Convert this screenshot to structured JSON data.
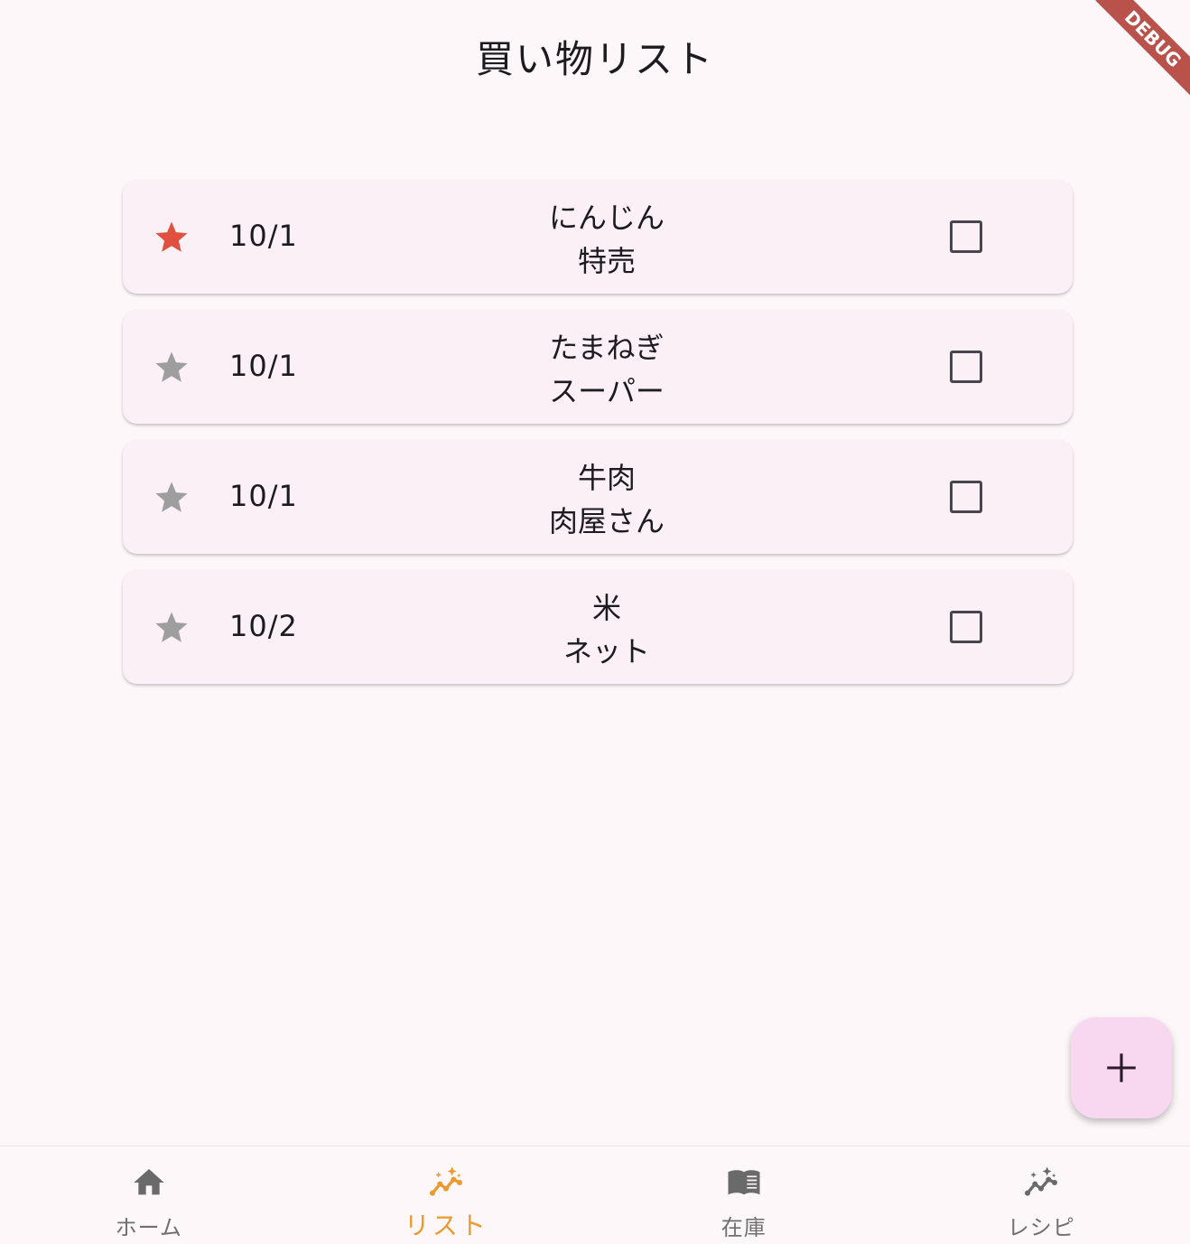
{
  "app": {
    "title": "買い物リスト",
    "debug_banner": "DEBUG"
  },
  "colors": {
    "star_active": "#e0503f",
    "star_inactive": "#9e9e9e",
    "nav_active": "#eb9a2e",
    "fab_bg": "#f8d8f1"
  },
  "items": [
    {
      "starred": true,
      "date": "10/1",
      "name": "にんじん",
      "note": "特売",
      "checked": false
    },
    {
      "starred": false,
      "date": "10/1",
      "name": "たまねぎ",
      "note": "スーパー",
      "checked": false
    },
    {
      "starred": false,
      "date": "10/1",
      "name": "牛肉",
      "note": "肉屋さん",
      "checked": false
    },
    {
      "starred": false,
      "date": "10/2",
      "name": "米",
      "note": "ネット",
      "checked": false
    }
  ],
  "fab": {
    "icon": "plus-icon"
  },
  "bottom_nav": [
    {
      "label": "ホーム",
      "icon": "home-icon",
      "active": false
    },
    {
      "label": "リスト",
      "icon": "sparkle-chart-icon",
      "active": true
    },
    {
      "label": "在庫",
      "icon": "book-icon",
      "active": false
    },
    {
      "label": "レシピ",
      "icon": "sparkle-chart-icon",
      "active": false
    }
  ]
}
